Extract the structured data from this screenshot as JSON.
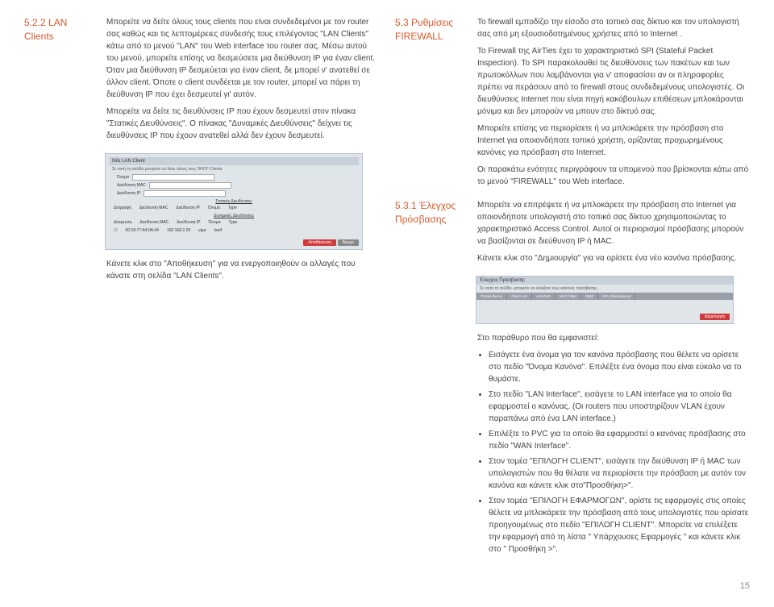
{
  "left": {
    "section_num": "5.2.2 LAN Clients",
    "p1": "Μπορείτε να δείτε όλους τους clients που είναι συνδεδεμένοι με τον router σας καθώς και τις λεπτομέρειες σύνδεσής τους επιλέγοντας \"LAN Clients\" κάτω από το μενού \"LAN\" του Web interface του router σας. Μέσω αυτού του μενού, μπορείτε επίσης να δεσμεύσετε μια διεύθυνση IP για έναν client. Όταν μια διεύθυνση IP δεσμεύεται για έναν client, δε μπορεί ν' ανατεθεί σε άλλον client. Όποτε ο client συνδέεται με τον router, μπορεί να πάρει τη διεύθυνση IP που έχει δεσμευτεί γι' αυτόν.",
    "p2": "Μπορείτε να δείτε τις διευθύνσεις IP που έχουν δεσμευτεί στον πίνακα \"Στατικές Διευθύνσεις\". Ο πίνακας \"Δυναμικές Διευθύνσεις\" δείχνει τις διευθύνσεις IP που έχουν ανατεθεί αλλά δεν έχουν δεσμευτεί.",
    "p3": "Κάνετε κλικ στο \"Αποθήκευση\" για να ενεργοποιηθούν οι αλλαγές που κάνατε στη σελίδα \"LAN Clients\".",
    "mock1": {
      "title": "Νέα LAN Client",
      "sub": "Σε αυτή τη σελίδα μπορείτε να δείτε όλους τους DHCP Clients.",
      "lbl_name": "Όνομα",
      "lbl_mac": "Διεύθυνση MAC",
      "lbl_ip": "Διεύθυνση IP",
      "section_static": "Στατικές Διευθύνσεις",
      "col_del": "Διαγραφή",
      "col_mac": "Διεύθυνση MAC",
      "col_ip": "Διεύθυνση IP",
      "col_name": "Όνομα",
      "col_type": "Type",
      "section_dynamic": "Δυναμικές Διευθύνσεις",
      "col_reserve": "Δέσμευση",
      "row_mac": "00:18:77:A4:0A:44",
      "row_ip": "192.168.2.29",
      "row_name": "vgur",
      "row_type": "lanif",
      "btn_save": "Αποθήκευση",
      "btn_cancel": "Άκυρο"
    }
  },
  "right": {
    "section_53": "5.3 Ρυθμίσεις FIREWALL",
    "p53_1": "Το firewall εμποδίζει την είσοδο στο τοπικό σας δίκτυο και τον υπολογιστή σας  από μη εξουσιοδοτημένους χρήστες από το Internet .",
    "p53_2": "Το Firewall της AirTies έχει το χαρακτηριστικό SPI (Stateful Packet Inspection). Το SPI παρακολουθεί τις διευθύνσεις των πακέτων και των πρωτοκόλλων που λαμβάνονται για ν' αποφασίσει αν οι πληροφορίες πρέπει να περάσουν από το firewall στους συνδεδεμένους υπολογιστές. Οι διευθύνσεις Internet  που είναι πηγή κακόβουλων επιθέσεων μπλοκάρονται μόνιμα  και δεν μπορούν να μπουν στο δίκτυό σας.",
    "p53_3": "Μπορείτε επίσης να περιορίσετε ή να μπλοκάρετε την πρόσβαση στο Internet για οποιονδήποτε τοπικό χρήστη, ορίζοντας προχωρημένους κανόνες για πρόσβαση στο Internet.",
    "p53_4": "Οι παρακάτω ενότητες περιγράφουν τα υπομενού που βρίσκονται κάτω από το μενού \"FIREWALL\" του Web interface.",
    "section_531": "5.3.1 Έλεγχος Πρόσβασης",
    "p531_1": "Μπορείτε να επιτρέψετε ή να μπλοκάρετε την πρόσβαση στο Internet για οποιονδήποτε υπολογιστή  στο τοπικό σας δίκτυο χρησιμοποιώντας το χαρακτηριστικό Access Control. Αυτοί οι περιορισμοί πρόσβασης μπορούν να βασίζονται σε διεύθυνση IP ή MAC.",
    "p531_2": "Κάνετε κλικ στο \"Δημιουργία\" για να ορίσετε ένα νέο κανόνα πρόσβασης.",
    "mock2": {
      "title": "Έλεγχος Πρόσβασης",
      "sub": "Σε αυτή τη σελίδα, μπορείτε να ελέγξετε τους κανόνες πρόσβασης.",
      "tab1": "Τοπικό δίκτυο",
      "tab2": "Client List",
      "tab3": "Anti-DoS",
      "tab4": "MAC Filter",
      "tab5": "DMZ",
      "tab6": "URL Φιλτράρισμα",
      "btn_create": "Δημιουργία"
    },
    "p531_3": "Στο παράθυρο που θα εμφανιστεί:",
    "b1": "Εισάγετε ένα όνομα για τον κανόνα πρόσβασης που θέλετε να ορίσετε στο πεδίο \"Όνομα Κανόνα\". Επιλέξτε ένα όνομα που είναι εύκολο να το θυμάστε.",
    "b2": "Στο πεδίο \"LAN Interface\", εισάγετε το LAN interface για το οποίο θα εφαρμοστεί ο κανόνας. (Οι routers που υποστηρίζουν VLAN έχουν παραπάνω από ένα LAN interface.)",
    "b3": "Επιλέξτε το PVC για το οποίο θα εφαρμοστεί ο κανόνας  πρόσβασης στο πεδίο \"WAN Interface\".",
    "b4": "Στον τομέα \"ΕΠΙΛΟΓΗ CLIENT\", εισάγετε την διεύθυνση IP ή MAC των υπολογιστών που θα θέλατε να περιορίσετε την πρόσβαση με αυτόν τον κανόνα και κάνετε κλικ στο\"Προσθήκη>\".",
    "b5": "Στον τομέα \"ΕΠΙΛΟΓΗ ΕΦΑΡΜΟΓΩΝ\", ορίστε τις εφαρμογές στις οποίες θέλετε να μπλοκάρετε την πρόσβαση από τους υπολογιστές που ορίσατε προηγουμένως στο πεδίο \"ΕΠΙΛΟΓΗ CLIENT\". Μπορείτε να επιλέξετε την εφαρμογή από τη λίστα \" Υπάρχουσες Εφαρμογές \" και κάνετε κλικ στο \" Προσθήκη >\"."
  },
  "page_number": "15"
}
